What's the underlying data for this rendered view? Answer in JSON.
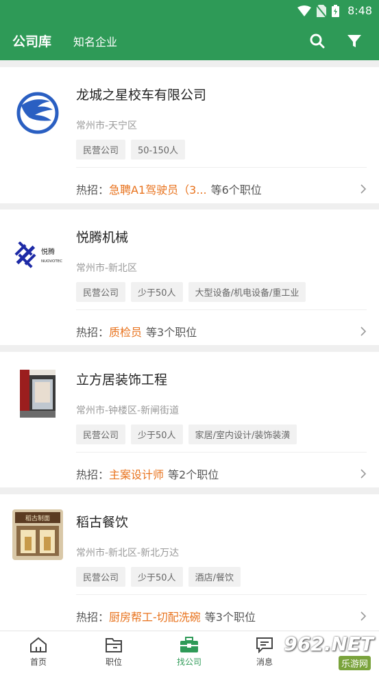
{
  "status_bar": {
    "time": "8:48"
  },
  "header": {
    "tab_active": "公司库",
    "tab_other": "知名企业"
  },
  "companies": [
    {
      "name": "龙城之星校车有限公司",
      "location": "常州市-天宁区",
      "tags": [
        "民营公司",
        "50-150人"
      ],
      "hot_label": "热招：",
      "hot_job": "急聘A1驾驶员（3...",
      "hot_count": "等6个职位"
    },
    {
      "name": "悦腾机械",
      "location": "常州市-新北区",
      "tags": [
        "民营公司",
        "少于50人",
        "大型设备/机电设备/重工业"
      ],
      "hot_label": "热招：",
      "hot_job": "质检员",
      "hot_count": "等3个职位"
    },
    {
      "name": "立方居装饰工程",
      "location": "常州市-钟楼区-新闸街道",
      "tags": [
        "民营公司",
        "少于50人",
        "家居/室内设计/装饰装潢"
      ],
      "hot_label": "热招：",
      "hot_job": "主案设计师",
      "hot_count": "等2个职位"
    },
    {
      "name": "稻古餐饮",
      "location": "常州市-新北区-新北万达",
      "tags": [
        "民营公司",
        "少于50人",
        "酒店/餐饮"
      ],
      "hot_label": "热招：",
      "hot_job": "厨房帮工-切配洗碗",
      "hot_count": "等3个职位"
    }
  ],
  "logos": {
    "c2_cn": "悦腾",
    "c2_en": "NUOVOTEC",
    "c4_sign": "稻古制面"
  },
  "bottom_nav": [
    {
      "label": "首页"
    },
    {
      "label": "职位"
    },
    {
      "label": "找公司"
    },
    {
      "label": "消息"
    }
  ],
  "watermark": {
    "text": "962.NET",
    "site": "乐游网"
  },
  "colors": {
    "primary": "#2e9a57",
    "hot": "#e8721c"
  }
}
